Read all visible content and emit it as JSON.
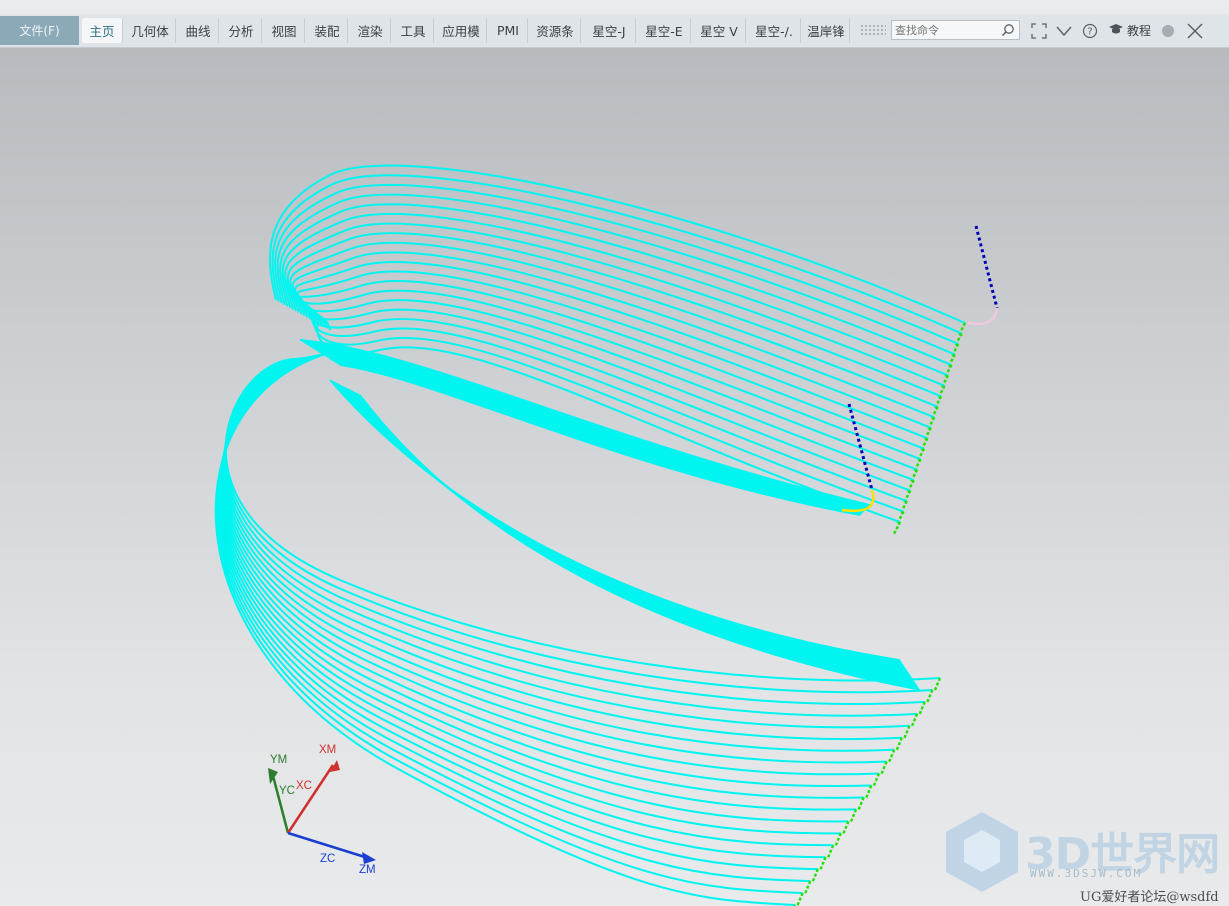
{
  "ribbon": {
    "file_tab": "文件(F)",
    "tabs": [
      "主页",
      "几何体",
      "曲线",
      "分析",
      "视图",
      "装配",
      "渲染",
      "工具",
      "应用模",
      "PMI",
      "资源条",
      "星空-J",
      "星空-E",
      "星空 V",
      "星空-/.",
      "温岸锋"
    ],
    "active_tab": "主页",
    "search_placeholder": "查找命令",
    "tutorial_label": "教程"
  },
  "triad": {
    "ym": "YM",
    "yc": "YC",
    "xm": "XM",
    "xc": "XC",
    "zc": "ZC",
    "zm": "ZM"
  },
  "watermark": {
    "brand": "3D世界网",
    "url": "WWW.3DSJW.COM",
    "forum": "UG爱好者论坛@wsdfd"
  },
  "colors": {
    "toolpath": "#00f5f0",
    "link_green": "#22e000",
    "approach_blue": "#0000b8",
    "arc_pink": "#f0c8e0",
    "arc_yellow": "#ffe000",
    "triad_red": "#d03030",
    "triad_green": "#2e7d2e",
    "triad_blue": "#1a3fd0"
  }
}
